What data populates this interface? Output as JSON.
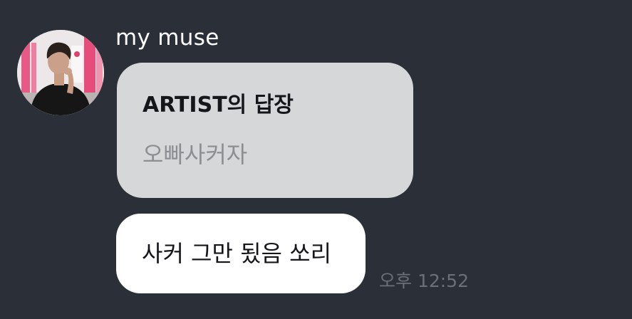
{
  "chat": {
    "sender": {
      "name": "my muse",
      "avatar_icon": "profile-photo"
    },
    "reply": {
      "title": "ARTIST의 답장",
      "quoted_text": "오빠사커자"
    },
    "message": {
      "text": "사커 그만 됬음 쏘리",
      "time": "오후 12:52"
    }
  },
  "colors": {
    "background": "#2b2f38",
    "reply_bubble": "#d6d7d9",
    "message_bubble": "#ffffff",
    "timestamp": "#6b6f78"
  }
}
